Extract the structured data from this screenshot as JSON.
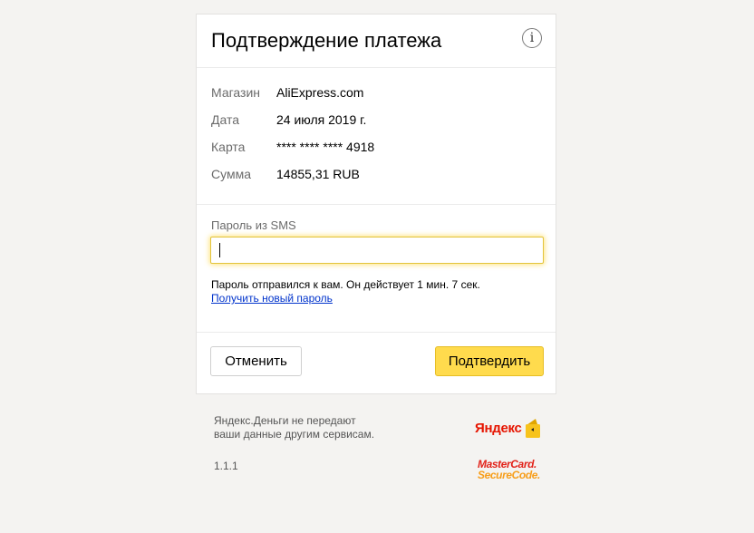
{
  "header": {
    "title": "Подтверждение платежа",
    "info_icon": "info-icon",
    "info_glyph": "i"
  },
  "details": {
    "rows": [
      {
        "label": "Магазин",
        "value": "AliExpress.com"
      },
      {
        "label": "Дата",
        "value": "24 июля 2019 г."
      },
      {
        "label": "Карта",
        "value": "**** **** **** 4918"
      },
      {
        "label": "Сумма",
        "value": "14855,31 RUB"
      }
    ]
  },
  "sms": {
    "label": "Пароль из SMS",
    "value": "",
    "note": "Пароль отправился к вам. Он действует 1 мин. 7 сек.",
    "resend_link": "Получить новый пароль"
  },
  "actions": {
    "cancel_label": "Отменить",
    "confirm_label": "Подтвердить"
  },
  "footer": {
    "disclaimer_line1": "Яндекс.Деньги не передают",
    "disclaimer_line2": "ваши данные другим сервисам.",
    "version": "1.1.1",
    "yandex_logo_text": "Яндекс",
    "securecode_line1": "MasterCard.",
    "securecode_line2": "SecureCode."
  },
  "colors": {
    "page_background": "#f4f3f1",
    "confirm_button": "#ffdb4d",
    "input_focus_glow": "#ffdb4d",
    "link": "#0033cc",
    "yandex_red": "#e61400",
    "yandex_wallet_yellow": "#f7c31c",
    "mastercard_red": "#e2231a",
    "mastercard_orange": "#f79e1b"
  }
}
